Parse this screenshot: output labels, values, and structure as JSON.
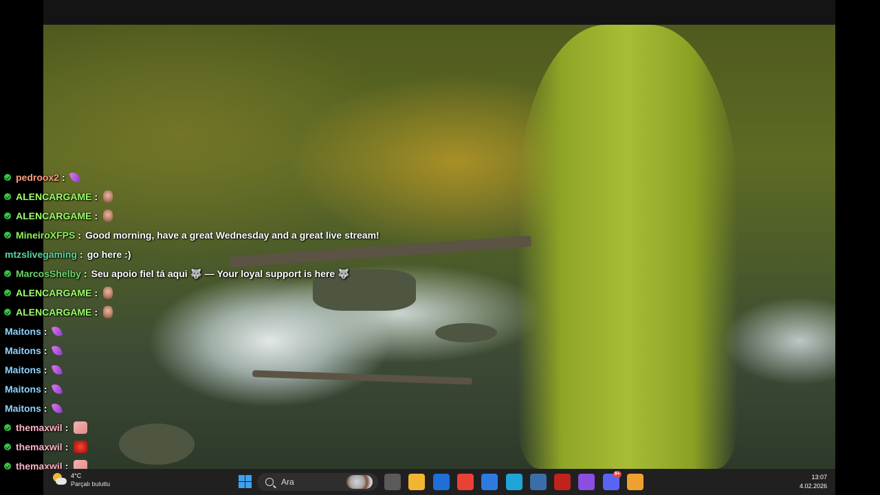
{
  "chat": {
    "messages": [
      {
        "user": "pedroox2",
        "user_color": "#ff9f80",
        "verified": true,
        "text": "",
        "emotes": [
          "purple"
        ]
      },
      {
        "user": "ALENCARGAME",
        "user_color": "#9cff6a",
        "verified": true,
        "text": "",
        "emotes": [
          "face"
        ]
      },
      {
        "user": "ALENCARGAME",
        "user_color": "#9cff6a",
        "verified": true,
        "text": "",
        "emotes": [
          "face"
        ]
      },
      {
        "user": "MineiroXFPS",
        "user_color": "#8ff05a",
        "verified": true,
        "text": "Good morning, have a great Wednesday and a great live stream!",
        "emotes": []
      },
      {
        "user": "mtzslivegaming",
        "user_color": "#5ad6a0",
        "verified": false,
        "text": "go here :)",
        "emotes": []
      },
      {
        "user": "MarcosShelby",
        "user_color": "#6bd66b",
        "verified": true,
        "text": "Seu apoio fiel tá aqui 🐺 — Your loyal support is here 🐺",
        "emotes": []
      },
      {
        "user": "ALENCARGAME",
        "user_color": "#9cff6a",
        "verified": true,
        "text": "",
        "emotes": [
          "face"
        ]
      },
      {
        "user": "ALENCARGAME",
        "user_color": "#9cff6a",
        "verified": true,
        "text": "",
        "emotes": [
          "face"
        ]
      },
      {
        "user": "Maitons",
        "user_color": "#8fd4ff",
        "verified": false,
        "text": "",
        "emotes": [
          "purple"
        ]
      },
      {
        "user": "Maitons",
        "user_color": "#8fd4ff",
        "verified": false,
        "text": "",
        "emotes": [
          "purple"
        ]
      },
      {
        "user": "Maitons",
        "user_color": "#8fd4ff",
        "verified": false,
        "text": "",
        "emotes": [
          "purple"
        ]
      },
      {
        "user": "Maitons",
        "user_color": "#8fd4ff",
        "verified": false,
        "text": "",
        "emotes": [
          "purple"
        ]
      },
      {
        "user": "Maitons",
        "user_color": "#8fd4ff",
        "verified": false,
        "text": "",
        "emotes": [
          "purple"
        ]
      },
      {
        "user": "themaxwil",
        "user_color": "#ffb3c6",
        "verified": true,
        "text": "",
        "emotes": [
          "pink"
        ]
      },
      {
        "user": "themaxwil",
        "user_color": "#ffb3c6",
        "verified": true,
        "text": "",
        "emotes": [
          "red"
        ]
      },
      {
        "user": "themaxwil",
        "user_color": "#ffb3c6",
        "verified": true,
        "text": "",
        "emotes": [
          "pink"
        ]
      }
    ]
  },
  "taskbar": {
    "weather_temp": "4°C",
    "weather_desc": "Parçalı bulutlu",
    "search_placeholder": "Ara",
    "apps": [
      {
        "name": "task-view-icon",
        "color": "#5a5a5a"
      },
      {
        "name": "file-explorer-icon",
        "color": "#f2b531"
      },
      {
        "name": "mail-icon",
        "color": "#1f6fd6"
      },
      {
        "name": "chrome-icon",
        "color": "#e94235"
      },
      {
        "name": "store-icon",
        "color": "#2d7be0"
      },
      {
        "name": "edge-icon",
        "color": "#1fa4d8"
      },
      {
        "name": "calculator-icon",
        "color": "#3b6ea8"
      },
      {
        "name": "record-app-icon",
        "color": "#c0231b"
      },
      {
        "name": "gem-app-icon",
        "color": "#8a4fe0"
      },
      {
        "name": "discord-icon",
        "color": "#5865f2",
        "badge": "9+"
      },
      {
        "name": "colorful-app-icon",
        "color": "#f0a030"
      }
    ],
    "time": "13:07",
    "date": "4.02.2026"
  }
}
